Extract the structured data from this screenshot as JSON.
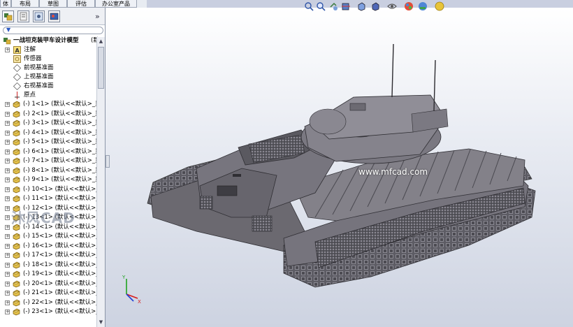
{
  "tabs": [
    {
      "label": "体",
      "name": "tab-features"
    },
    {
      "label": "布局",
      "name": "tab-layout"
    },
    {
      "label": "草图",
      "name": "tab-sketch"
    },
    {
      "label": "评估",
      "name": "tab-evaluate"
    },
    {
      "label": "办公室产品",
      "name": "tab-office-products"
    }
  ],
  "panel": {
    "collapse_glyph": "»",
    "filter_glyph": "▼"
  },
  "tree": {
    "root_label": "一战坦克装甲车设计模型",
    "root_suffix": "(默",
    "items": [
      {
        "label": "注解",
        "icon": "annotation-icon",
        "expandable": true
      },
      {
        "label": "传感器",
        "icon": "sensor-icon",
        "expandable": false
      },
      {
        "label": "前视基准面",
        "icon": "plane-icon",
        "expandable": false
      },
      {
        "label": "上视基准面",
        "icon": "plane-icon",
        "expandable": false
      },
      {
        "label": "右视基准面",
        "icon": "plane-icon",
        "expandable": false
      },
      {
        "label": "原点",
        "icon": "origin-icon",
        "expandable": false
      }
    ],
    "parts": [
      "(-) 1<1> (默认<<默认>_显",
      "(-) 2<1> (默认<<默认>_显",
      "(-) 3<1> (默认<<默认>_显",
      "(-) 4<1> (默认<<默认>_显",
      "(-) 5<1> (默认<<默认>_显",
      "(-) 6<1> (默认<<默认>_显",
      "(-) 7<1> (默认<<默认>_显",
      "(-) 8<1> (默认<<默认>_显",
      "(-) 9<1> (默认<<默认>_显",
      "(-) 10<1> (默认<<默认>_",
      "(-) 11<1> (默认<<默认>_",
      "(-) 12<1> (默认<<默认>_",
      "(-) 13<1> (默认<<默认>_",
      "(-) 14<1> (默认<<默认>_",
      "(-) 15<1> (默认<<默认>_",
      "(-) 16<1> (默认<<默认>_",
      "(-) 17<1> (默认<<默认>_",
      "(-) 18<1> (默认<<默认>_",
      "(-) 19<1> (默认<<默认>_",
      "(-) 20<1> (默认<<默认>_",
      "(-) 21<1> (默认<<默认>_",
      "(-) 22<1> (默认<<默认>_",
      "(-) 23<1> (默认<<默认>_"
    ]
  },
  "viewport": {
    "watermark_url": "www.mfcad.com",
    "watermark_logo": "沐风CAD",
    "toolbar_icons": [
      "zoom-to-fit-icon",
      "zoom-area-icon",
      "previous-view-icon",
      "section-view-icon",
      "view-orientation-icon",
      "display-style-icon",
      "hide-show-icon",
      "edit-appearance-icon",
      "apply-scene-icon",
      "view-settings-icon"
    ]
  },
  "colors": {
    "model_body": "#6e6c75",
    "model_dark": "#3f3e45",
    "model_light": "#8d8b94",
    "background_top": "#ffffff",
    "background_bottom": "#cdd3e1"
  }
}
